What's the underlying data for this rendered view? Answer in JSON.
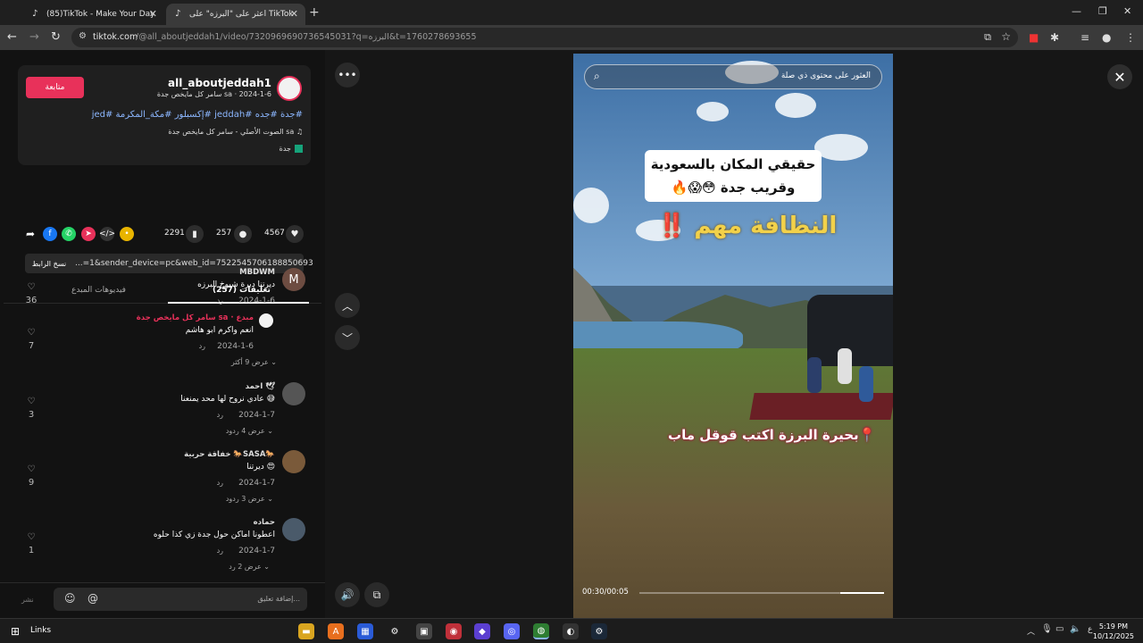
{
  "browser": {
    "tabs": [
      {
        "title": "(85)TikTok - Make Your Day"
      },
      {
        "title": "اعثر على \"البرزه\" على TikTok"
      }
    ],
    "url_host": "tiktok.com",
    "url_path": "/@all_aboutjeddah1/video/7320969690736545031?q=البرزه&t=1760278693655"
  },
  "post": {
    "follow_label": "متابعة",
    "username": "all_aboutjeddah1",
    "meta": "سامر كل مايخص جدة sa · 2024-1-6",
    "hashtags": "#جدة #جده #jeddah #إكسبلور #مكة_المكرمة #jed",
    "sound": "الصوت الأصلي - سامر كل مايخص جدة sa",
    "location": "جدة",
    "likes": "4567",
    "comments": "257",
    "saves": "2291",
    "link_text": "...=1&sender_device=pc&web_id=7522545706188850693",
    "copy_link_label": "نسخ الرابط"
  },
  "tabs": {
    "comments_label": "تعليقات (257)",
    "creator_videos_label": "فيديوهات المبدع"
  },
  "comments": [
    {
      "name": "MBDWM",
      "text": "ديرتنا ديرة شيوخ البرزه",
      "date": "2024-1-6",
      "reply": "رد",
      "likes": "36",
      "avatar": "M"
    },
    {
      "name": "سامر كل مايخص جدة sa · مبدع",
      "text": "انعم واكرم ابو هاشم",
      "date": "2024-1-6",
      "reply": "رد",
      "likes": "7",
      "more": "عرض 9 أكثر"
    },
    {
      "name": "احمد 🕊",
      "text": "عادي نروح لها محد يمنعنا 😅",
      "date": "2024-1-7",
      "reply": "رد",
      "likes": "3",
      "more": "عرض 4 ردود"
    },
    {
      "name": "خفاقة حربية 🐎SASA🐎",
      "text": "ديرتنا 😍",
      "date": "2024-1-7",
      "reply": "رد",
      "likes": "9",
      "more": "عرض 3 ردود"
    },
    {
      "name": "حماده",
      "text": "اعطونا اماكن حول جدة زي كذا حلوه",
      "date": "2024-1-7",
      "reply": "رد",
      "likes": "1",
      "more": "عرض 2 رد"
    }
  ],
  "input": {
    "placeholder": "إضافة تعليق...",
    "post_label": "نشر"
  },
  "video": {
    "search_placeholder": "العثور على محتوى ذي صلة",
    "caption_line1": "حقيقي المكان بالسعودية",
    "caption_line2": "وقريب جدة 😳😱🔥",
    "caption_big": "النظافة مهم ‼️",
    "caption_bottom": "📍بحيرة البرزة اكتب قوقل ماب",
    "time": "00:30/00:05",
    "progress_fraction": 0.18
  },
  "taskbar": {
    "links_label": "Links",
    "time": "5:19 PM",
    "date": "10/12/2025"
  },
  "colors": {
    "accent": "#e8315a",
    "hashtag": "#8cb7ff"
  }
}
